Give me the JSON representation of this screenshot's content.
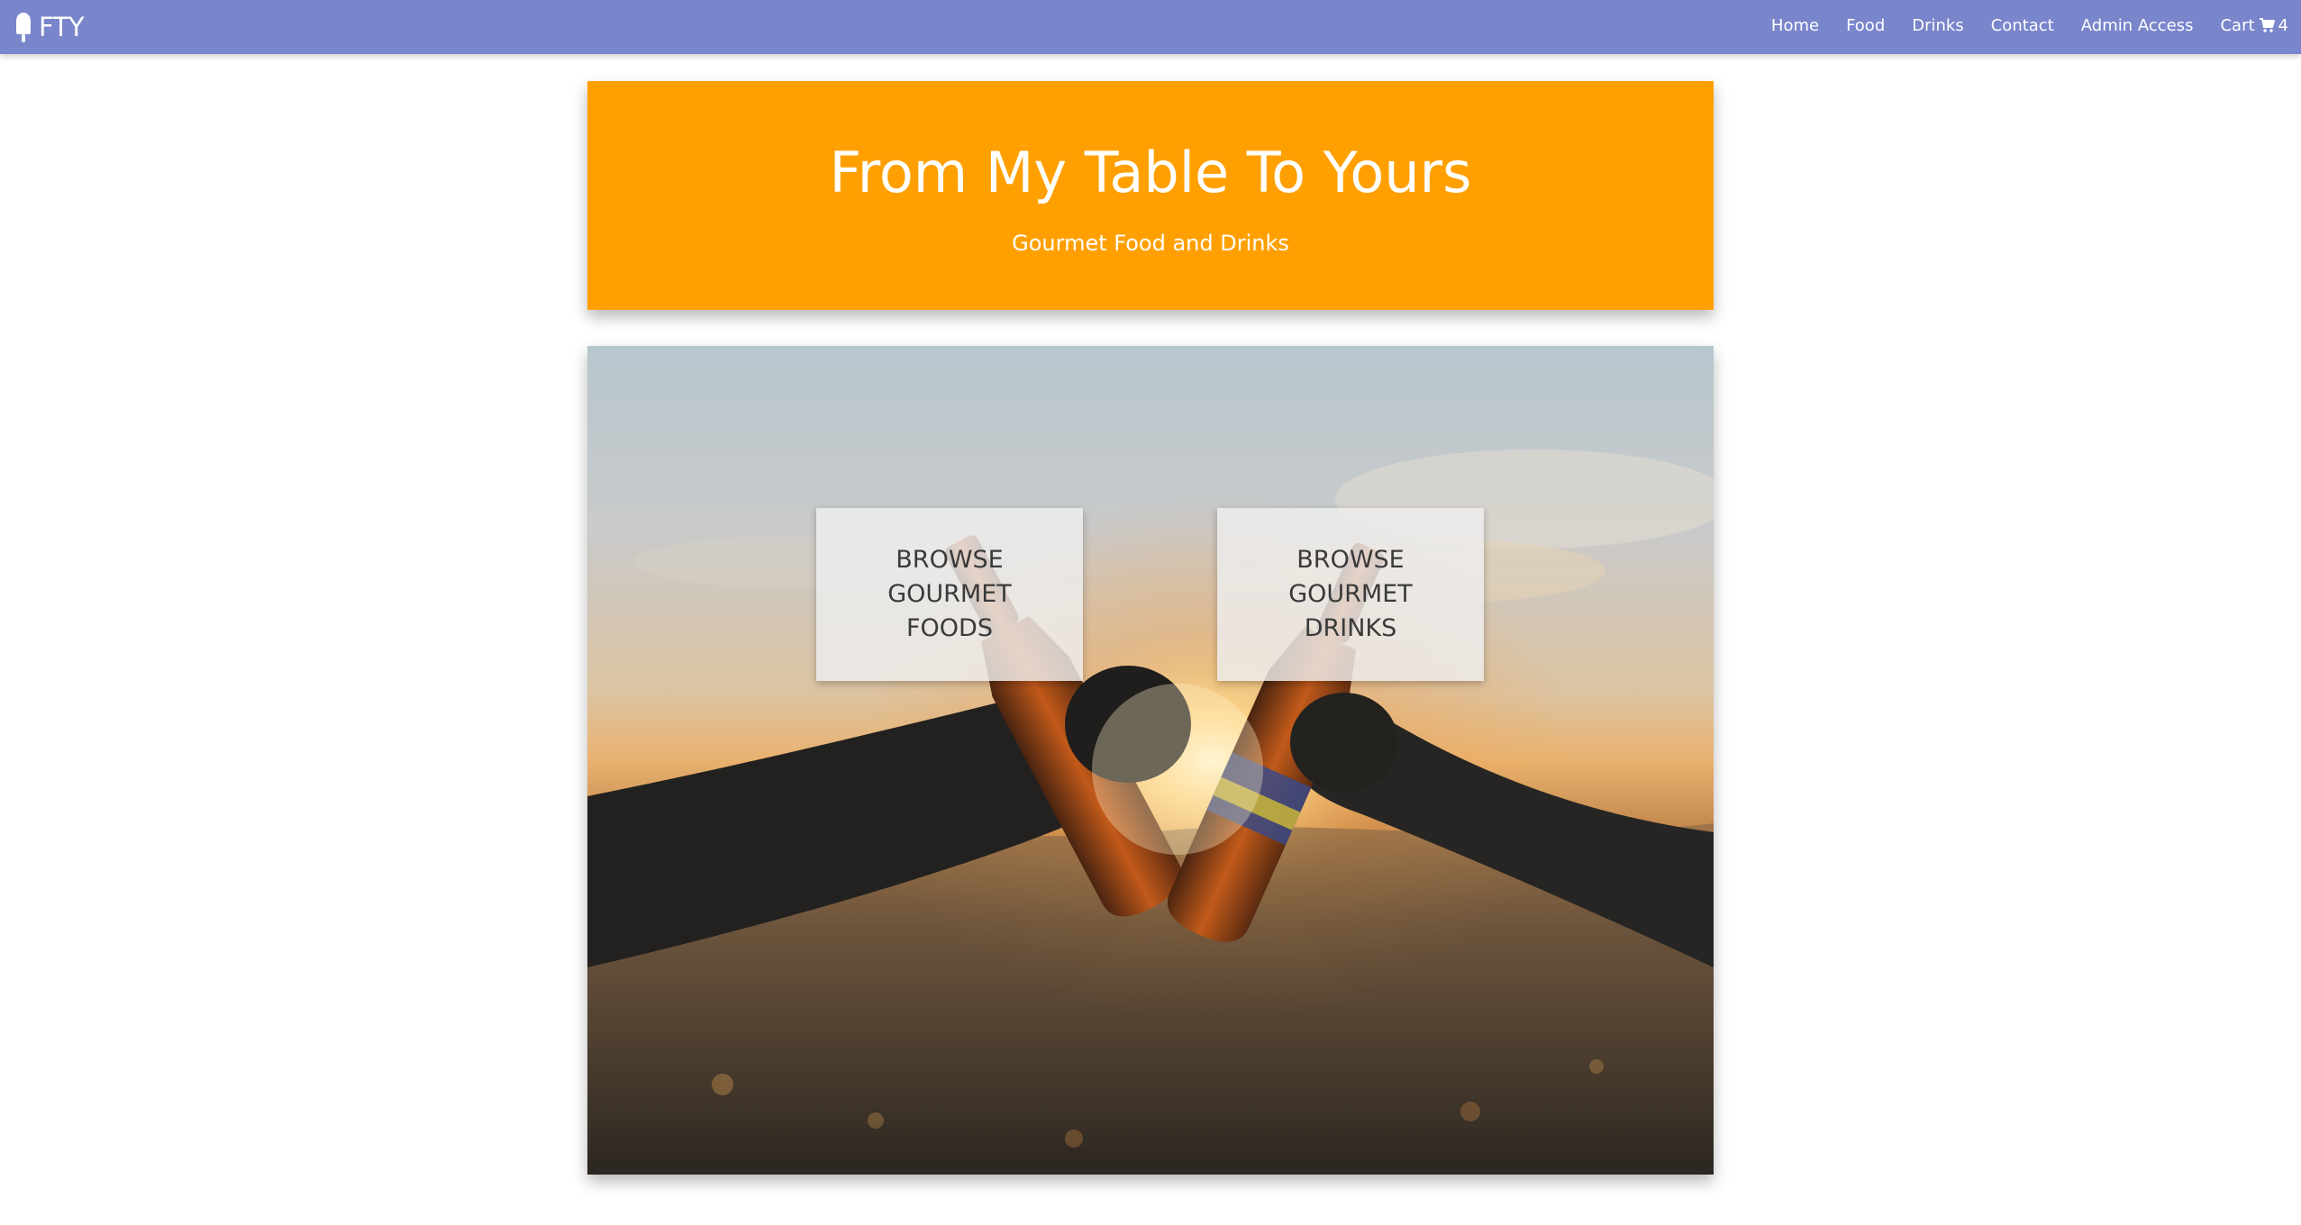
{
  "navbar": {
    "brand": "FTY",
    "brand_icon": "popsicle-icon",
    "background": "#7986cb",
    "links": [
      {
        "label": "Home"
      },
      {
        "label": "Food"
      },
      {
        "label": "Drinks"
      },
      {
        "label": "Contact"
      },
      {
        "label": "Admin Access"
      }
    ],
    "cart": {
      "label": "Cart",
      "icon": "cart-icon",
      "count": "4"
    }
  },
  "hero": {
    "title": "From My Table To Yours",
    "subtitle": "Gourmet Food and Drinks",
    "background": "#ffa000"
  },
  "main": {
    "photo": "two-hands-clinking-bottles-at-sunset",
    "browse_foods_label": "BROWSE GOURMET FOODS",
    "browse_drinks_label": "BROWSE GOURMET DRINKS"
  }
}
